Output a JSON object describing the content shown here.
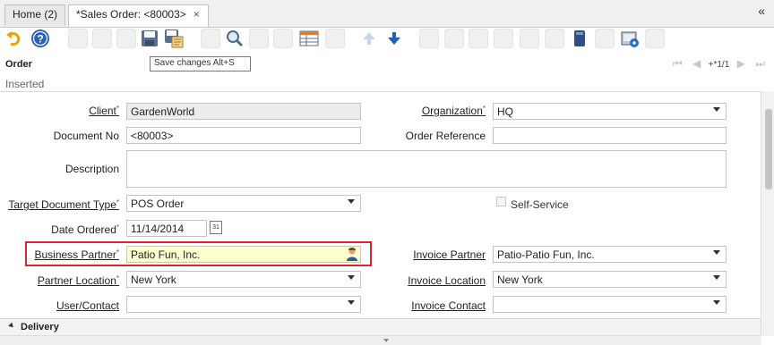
{
  "tabs": [
    {
      "label": "Home (2)"
    },
    {
      "label": "*Sales Order: <80003>",
      "close": "×"
    }
  ],
  "collapse_glyph": "«",
  "toolbar": {
    "tooltip": "Save changes    Alt+S",
    "icons": [
      "undo-icon",
      "help-icon",
      "new-record-icon",
      "copy-record-icon",
      "delete-icon",
      "save-icon",
      "save-new-icon",
      "refresh-icon",
      "find-icon",
      "attachment-icon",
      "chat-icon",
      "grid-toggle-icon",
      "history-icon",
      "parent-record-icon",
      "detail-record-icon",
      "report-icon",
      "archive-icon",
      "print-icon",
      "zoom-across-icon",
      "active-workflows-icon",
      "requests-icon",
      "product-info-icon",
      "process-icon",
      "customize-icon",
      "export-icon",
      "post-icon"
    ]
  },
  "panel": {
    "title": "Order",
    "status": "Inserted"
  },
  "navigation": {
    "record": "+*1/1"
  },
  "form": {
    "client": {
      "label": "Client",
      "value": "GardenWorld"
    },
    "organization": {
      "label": "Organization",
      "value": "HQ"
    },
    "document_no": {
      "label": "Document No",
      "value": "<80003>"
    },
    "order_reference": {
      "label": "Order Reference",
      "value": ""
    },
    "description": {
      "label": "Description",
      "value": ""
    },
    "target_doc_type": {
      "label": "Target Document Type",
      "value": "POS Order"
    },
    "self_service": {
      "label": "Self-Service"
    },
    "date_ordered": {
      "label": "Date Ordered",
      "value": "11/14/2014",
      "calendar_day": "31"
    },
    "business_partner": {
      "label": "Business Partner",
      "value": "Patio Fun, Inc."
    },
    "invoice_partner": {
      "label": "Invoice Partner",
      "value": "Patio-Patio Fun, Inc."
    },
    "partner_location": {
      "label": "Partner Location",
      "value": "New York"
    },
    "invoice_location": {
      "label": "Invoice Location",
      "value": "New York"
    },
    "user_contact": {
      "label": "User/Contact",
      "value": ""
    },
    "invoice_contact": {
      "label": "Invoice Contact",
      "value": ""
    }
  },
  "section": {
    "label": "Delivery"
  },
  "colors": {
    "highlight_border": "#d9262c",
    "field_highlight": "#fefed0",
    "readonly": "#ececec"
  }
}
